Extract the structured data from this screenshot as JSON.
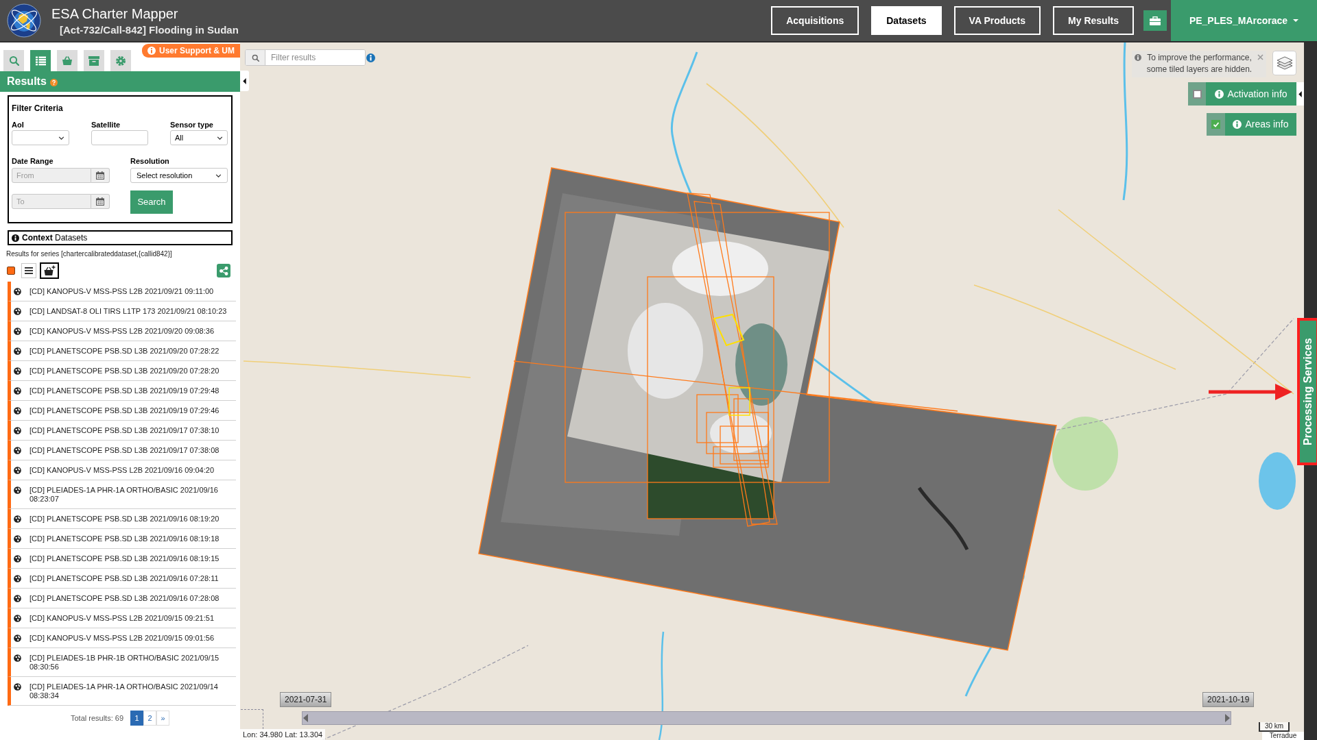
{
  "header": {
    "title": "ESA Charter Mapper",
    "subtitle": "[Act-732/Call-842] Flooding in Sudan",
    "nav": [
      {
        "label": "Acquisitions",
        "selected": false
      },
      {
        "label": "Datasets",
        "selected": true
      },
      {
        "label": "VA Products",
        "selected": false
      },
      {
        "label": "My Results",
        "selected": false
      }
    ],
    "user": "PE_PLES_MArcorace"
  },
  "sidebar": {
    "tools": [
      {
        "kind": "search",
        "selected": false
      },
      {
        "kind": "list",
        "selected": true
      },
      {
        "kind": "basket",
        "selected": false
      },
      {
        "kind": "archive",
        "selected": false
      },
      {
        "kind": "settings",
        "selected": false
      }
    ],
    "support_link": "User Support & UM",
    "panel_title": "Results",
    "filter": {
      "title": "Filter Criteria",
      "aoi": {
        "label": "AoI"
      },
      "satellite": {
        "label": "Satellite"
      },
      "sensor_type": {
        "label": "Sensor type",
        "value": "All"
      },
      "date_range": {
        "label": "Date Range",
        "from_placeholder": "From",
        "to_placeholder": "To"
      },
      "resolution": {
        "label": "Resolution",
        "value": "Select resolution"
      },
      "search_button": "Search"
    },
    "context_datasets": {
      "title": "**Context** Datasets"
    },
    "series_caption": "Results for series [chartercalibrateddataset,{callid842}]",
    "results": [
      {
        "label": "[CD] KANOPUS-V MSS-PSS L2B 2021/09/21 09:11:00"
      },
      {
        "label": "[CD] LANDSAT-8 OLI TIRS L1TP 173 2021/09/21 08:10:23"
      },
      {
        "label": "[CD] KANOPUS-V MSS-PSS L2B 2021/09/20 09:08:36"
      },
      {
        "label": "[CD] PLANETSCOPE PSB.SD L3B 2021/09/20 07:28:22"
      },
      {
        "label": "[CD] PLANETSCOPE PSB.SD L3B 2021/09/20 07:28:20"
      },
      {
        "label": "[CD] PLANETSCOPE PSB.SD L3B 2021/09/19 07:29:48"
      },
      {
        "label": "[CD] PLANETSCOPE PSB.SD L3B 2021/09/19 07:29:46"
      },
      {
        "label": "[CD] PLANETSCOPE PSB.SD L3B 2021/09/17 07:38:10"
      },
      {
        "label": "[CD] PLANETSCOPE PSB.SD L3B 2021/09/17 07:38:08"
      },
      {
        "label": "[CD] KANOPUS-V MSS-PSS L2B 2021/09/16 09:04:20"
      },
      {
        "label": "[CD] PLEIADES-1A PHR-1A ORTHO/BASIC 2021/09/16 08:23:07"
      },
      {
        "label": "[CD] PLANETSCOPE PSB.SD L3B 2021/09/16 08:19:20"
      },
      {
        "label": "[CD] PLANETSCOPE PSB.SD L3B 2021/09/16 08:19:18"
      },
      {
        "label": "[CD] PLANETSCOPE PSB.SD L3B 2021/09/16 08:19:15"
      },
      {
        "label": "[CD] PLANETSCOPE PSB.SD L3B 2021/09/16 07:28:11"
      },
      {
        "label": "[CD] PLANETSCOPE PSB.SD L3B 2021/09/16 07:28:08"
      },
      {
        "label": "[CD] KANOPUS-V MSS-PSS L2B 2021/09/15 09:21:51"
      },
      {
        "label": "[CD] KANOPUS-V MSS-PSS L2B 2021/09/15 09:01:56"
      },
      {
        "label": "[CD] PLEIADES-1B PHR-1B ORTHO/BASIC 2021/09/15 08:30:56"
      },
      {
        "label": "[CD] PLEIADES-1A PHR-1A ORTHO/BASIC 2021/09/14 08:38:34"
      }
    ],
    "total": "Total results: 69",
    "pages": [
      {
        "label": "1",
        "selected": true
      },
      {
        "label": "2",
        "selected": false
      }
    ],
    "next": "»"
  },
  "map": {
    "filter_placeholder": "Filter results",
    "notice": "To improve the performance, some tiled layers are hidden.",
    "layers": [
      {
        "label": "Activation info",
        "checked": false
      },
      {
        "label": "Areas info",
        "checked": true
      }
    ],
    "processing_services": "Processing Services",
    "timeline": {
      "start": "2021-07-31",
      "end": "2021-10-19"
    },
    "coordinates": "Lon: 34.980 Lat: 13.304",
    "scale": "30 km",
    "attribution": "Terradue"
  }
}
